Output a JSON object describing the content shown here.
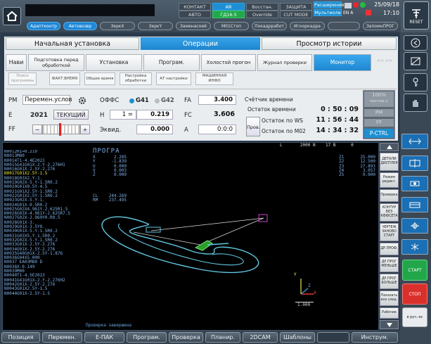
{
  "header": {
    "status_left": [
      "КОНТАКТ",
      "АВТО"
    ],
    "status_mid1": [
      "AR",
      "ГД16.5"
    ],
    "status_mid2": [
      "Восстан.",
      "Override"
    ],
    "status_mid3": [
      "ЗАЩИТА",
      "CUT MODE"
    ],
    "status_right": [
      "Расширения",
      "Мультиоле"
    ],
    "mode_letters": [
      "EN",
      "A"
    ],
    "date": "25/09/18",
    "time": "17:10"
  },
  "toolbar": {
    "pills": [
      "Адаптконтр",
      "Автовозвр",
      "ЗеркХ",
      "ЗеркY",
      "Заменасоей",
      "M01Стоп",
      "Покадрработ",
      "Игноркадра",
      "",
      "ЗапомнПРОГ"
    ],
    "active": [
      0,
      1
    ]
  },
  "tabs": {
    "main": [
      "Начальная установка",
      "Операции",
      "Просмотр истории"
    ],
    "sub": [
      "Нави",
      "Подготовка перед обработкой",
      "Установка",
      "Програм.",
      "Холостой прогон",
      "Журнал проверки",
      "Монитор"
    ],
    "subsub": [
      "Поиск программы",
      "ФАКТ.ВРЕМЯ",
      "Общее время",
      "Настройка обработки",
      "АТ настройки",
      "МАШИННАЯ ИНФО"
    ],
    "arrows": "<< >>"
  },
  "monitor": {
    "pm_label": "РМ",
    "pm_value": "Перемен.услов",
    "e_label": "E",
    "e_value": "2021",
    "e_button": "ТЕКУЩИЙ",
    "ff_label": "FF",
    "ff_minus": "−",
    "ff_plus": "+",
    "offs_label": "ОФФС",
    "g41": "G41",
    "g42": "G42",
    "h_label": "H",
    "h_value": "1",
    "h_eq": "=",
    "h_offset": "0.219",
    "ekvid_label": "Эквид.",
    "ekvid_value": "0.000",
    "fa_label": "FA",
    "fa_value": "3.400",
    "fc_label": "FC",
    "fc_value": "3.606",
    "a_label": "A",
    "a_value": "0:0:0",
    "timer_title": "Счётчик времени",
    "remain_label": "Остаток времени",
    "remain_value": "0 : 50 : 09",
    "prov_label": "Пров.",
    "ws_label": "Остаток по WS",
    "ws_value": "11 : 56 : 44",
    "m02_label": "Остаток по M02",
    "m02_value": "14 : 34 : 32",
    "pct": "100%",
    "pct_sub": "мастер у",
    "pm_btn": "РМ",
    "ff_btn": "FF",
    "pctrl": "P-CTRL"
  },
  "screen": {
    "header_right": "L       2000 N    17 B      0",
    "program_lines": [
      "N0012H1=0.219",
      "N0013M80",
      "N0014T1-4.4E2021",
      "N0015G41G01X-2.Y-2.276H1",
      "N0016G01X-2.5Y-2.276",
      "N0017G01X2.5Y-1.5",
      "N0018G03X2.Y-1.",
      "N0019G02X-5.Y-1.5R0.2",
      "N0020G01X0.5Y-4.5",
      "N0021G01X2.5Y-1.5R0.2",
      "N0022G01X2.5Y-1.5R0.2",
      "N0023G02X-5.Y-1.",
      "N0024G01X-0.5R0.2",
      "N0025G02X4.961Y-2.625R1.5",
      "N0026G03X-4.961Y-2.625R7.5",
      "N0027G02X-2.969Y0.R0.5",
      "N0028G01X-3.",
      "N0029G01X-3.5Y0.",
      "N0030G01X-5.Y-1.5R0.2",
      "N0031G03X5.Y-1.5R0.2",
      "N0032G02X-5.Y-1.5R0.2",
      "N0033G01X-2.5Y-2.276",
      "N0034G01X-2.5Y-2.276",
      "N0035G40G01X-2.5Y-1.876",
      "N0036G04X5.000",
      "N0037 EA03M80 D",
      "N0038X-0.149",
      "N0039M00",
      "N0040T1-4.5E2023",
      "N0041G41G01X-2.Y-2.276H2",
      "N0042G01X-2.5Y-2.276",
      "N0043G01X2.5Y-1.5",
      "N0044G01X-2.5Y-1.5"
    ],
    "prog_title": "ПРОГРА",
    "prog_axes": [
      "X",
      "Y",
      "U",
      "V",
      "Z"
    ],
    "prog_vals": [
      "2.285",
      "-1.839",
      "0.000",
      "0.003",
      "0.000"
    ],
    "cl_labels": [
      "CL",
      "RM"
    ],
    "cl_vals": [
      "244.269",
      "237.495"
    ],
    "right_labels": [
      "Z1",
      "Z2",
      "Z3",
      "Z4",
      "Z5"
    ],
    "right_vals": [
      "25.000",
      "12.500",
      "27.893",
      "3.057",
      "0.000"
    ],
    "status_msg": "Проверка завершена",
    "scale": "1.000",
    "axis_y": "Y",
    "axis_x": "X",
    "axis_z": "Z"
  },
  "vbuttons": [
    "ДЕТАЛИ ДИСПЛЕЯ",
    "Режим редакт.",
    "Проверка",
    "КОНТУР БЕЗ КФФСЕТА",
    "ЧЕРТЕЖ ЗАНОВО СТАРТ",
    "ДР.ПРОФ.",
    "ДР.ПРОГ МЕНЬШЕ",
    "ДР.ПРОГ БОЛЬШЕ",
    "Показать все след.",
    "Рабочие"
  ],
  "right_panel": {
    "reset": "RESET",
    "start": "СТАРТ",
    "stop": "СТОП",
    "manual": "в руч.-ес"
  },
  "footer": [
    "Позиция",
    "Перемен.",
    "Е-ПАК",
    "Програм.",
    "Проверка",
    "Планир.",
    "2DCAM",
    "Шаблоны",
    "Инструм."
  ],
  "colors": {
    "accent": "#1e8fd2",
    "start": "#22a64a",
    "stop": "#d9302b",
    "trace": "#62c6e0",
    "tool": "#c844c8"
  }
}
